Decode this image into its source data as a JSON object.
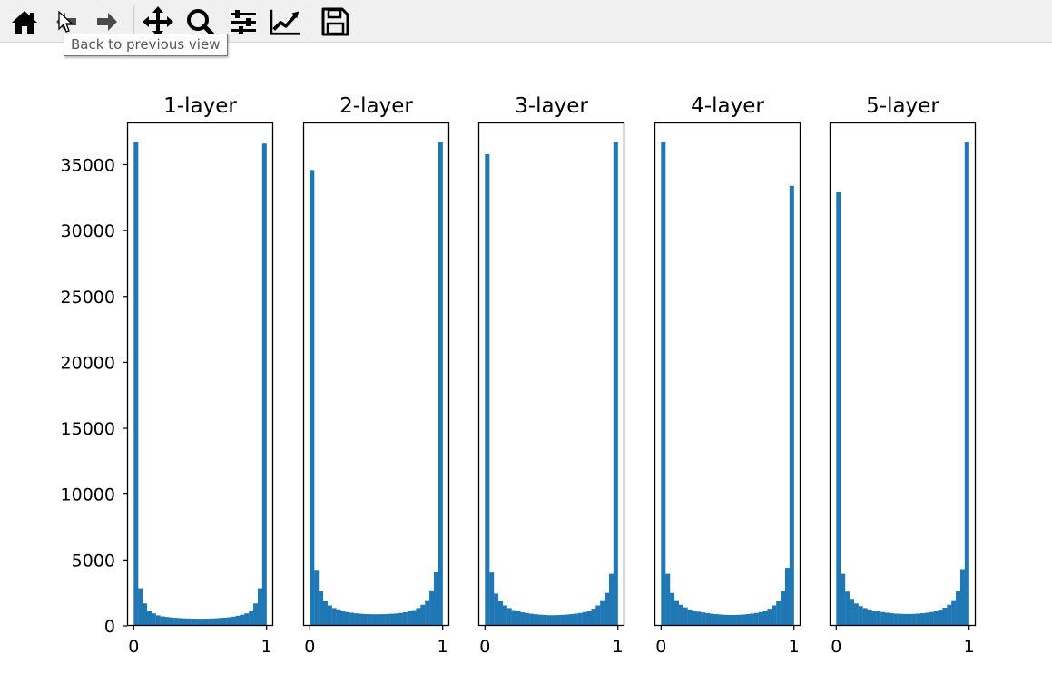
{
  "toolbar": {
    "buttons": [
      {
        "name": "home",
        "icon": "home-icon"
      },
      {
        "name": "back",
        "icon": "back-arrow-icon"
      },
      {
        "name": "forward",
        "icon": "forward-arrow-icon"
      },
      {
        "name": "pan",
        "icon": "move-icon"
      },
      {
        "name": "zoom",
        "icon": "zoom-icon"
      },
      {
        "name": "subplots",
        "icon": "sliders-icon"
      },
      {
        "name": "customize",
        "icon": "line-chart-icon"
      },
      {
        "name": "save",
        "icon": "floppy-disk-icon"
      }
    ],
    "tooltip": "Back to previous view"
  },
  "colors": {
    "bar": "#1f77b4",
    "toolbar_bg": "#f0f0f0",
    "icon": "#000000"
  },
  "chart_data": [
    {
      "type": "bar",
      "title": "1-layer",
      "x_range": [
        0,
        1
      ],
      "bins": 30,
      "xticks": [
        "0",
        "1"
      ],
      "ylim": [
        0,
        38200
      ],
      "yticks": [
        "0",
        "5000",
        "10000",
        "15000",
        "20000",
        "25000",
        "30000",
        "35000"
      ],
      "values": [
        36700,
        2850,
        1700,
        1150,
        950,
        800,
        720,
        680,
        640,
        610,
        590,
        570,
        560,
        550,
        545,
        545,
        550,
        560,
        575,
        600,
        620,
        650,
        700,
        770,
        850,
        950,
        1100,
        1700,
        2850,
        36600
      ]
    },
    {
      "type": "bar",
      "title": "2-layer",
      "x_range": [
        0,
        1
      ],
      "bins": 30,
      "xticks": [
        "0",
        "1"
      ],
      "ylim": [
        0,
        38200
      ],
      "values": [
        34600,
        4250,
        2650,
        1900,
        1550,
        1350,
        1250,
        1150,
        1050,
        1000,
        950,
        920,
        900,
        890,
        880,
        880,
        890,
        900,
        920,
        940,
        980,
        1030,
        1100,
        1200,
        1350,
        1600,
        1950,
        2700,
        4100,
        36700
      ]
    },
    {
      "type": "bar",
      "title": "3-layer",
      "x_range": [
        0,
        1
      ],
      "bins": 30,
      "xticks": [
        "0",
        "1"
      ],
      "ylim": [
        0,
        38200
      ],
      "values": [
        35800,
        4050,
        2450,
        1900,
        1550,
        1350,
        1200,
        1100,
        1030,
        970,
        920,
        880,
        850,
        830,
        810,
        810,
        820,
        840,
        860,
        890,
        930,
        980,
        1050,
        1150,
        1300,
        1550,
        1950,
        2500,
        3950,
        36700
      ]
    },
    {
      "type": "bar",
      "title": "4-layer",
      "x_range": [
        0,
        1
      ],
      "bins": 30,
      "xticks": [
        "0",
        "1"
      ],
      "ylim": [
        0,
        38200
      ],
      "values": [
        36700,
        3950,
        2500,
        1950,
        1600,
        1400,
        1250,
        1150,
        1080,
        1020,
        970,
        920,
        890,
        860,
        840,
        830,
        830,
        840,
        860,
        890,
        930,
        980,
        1050,
        1150,
        1300,
        1550,
        1900,
        2650,
        4400,
        33400
      ]
    },
    {
      "type": "bar",
      "title": "5-layer",
      "x_range": [
        0,
        1
      ],
      "bins": 30,
      "xticks": [
        "0",
        "1"
      ],
      "ylim": [
        0,
        38200
      ],
      "values": [
        32900,
        3950,
        2600,
        2050,
        1700,
        1500,
        1350,
        1250,
        1170,
        1100,
        1050,
        1000,
        960,
        930,
        910,
        900,
        900,
        910,
        930,
        960,
        1000,
        1050,
        1130,
        1230,
        1380,
        1600,
        1950,
        2650,
        4300,
        36700
      ]
    }
  ]
}
